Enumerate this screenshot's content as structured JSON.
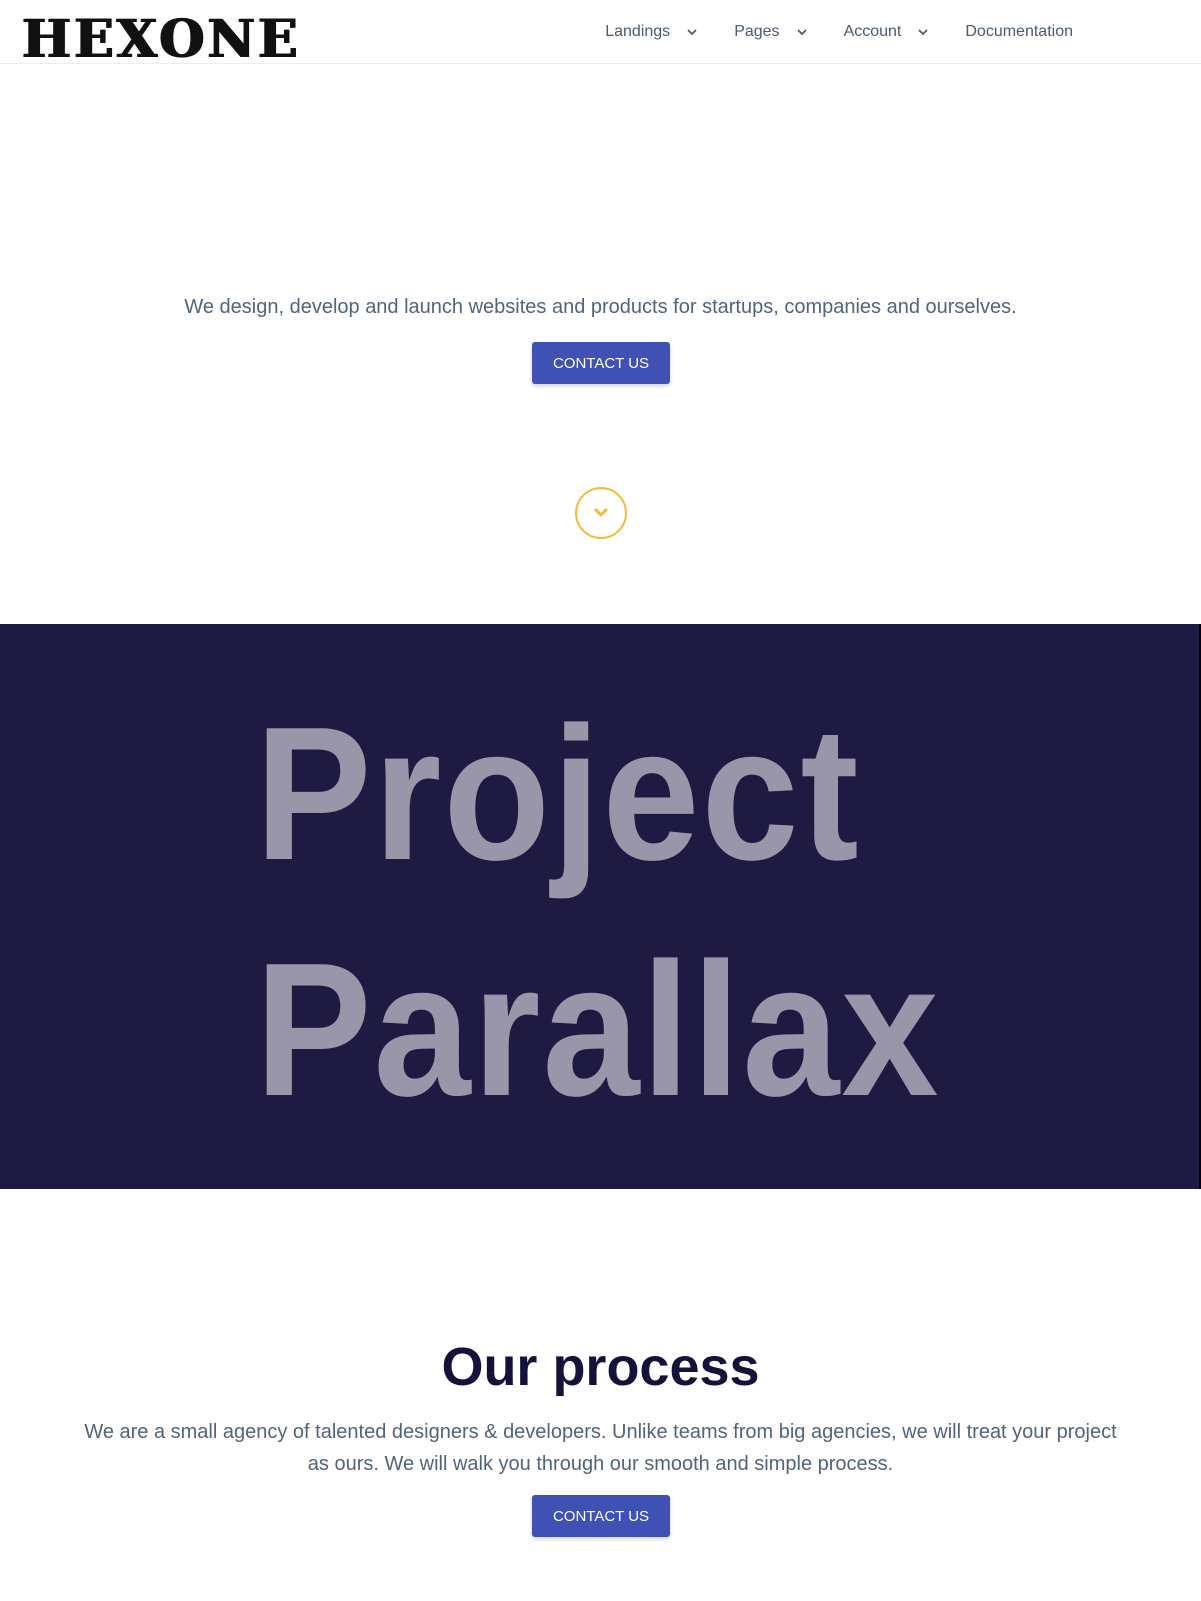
{
  "header": {
    "logo_text": "HEXONE",
    "nav": [
      {
        "label": "Landings",
        "has_dropdown": true
      },
      {
        "label": "Pages",
        "has_dropdown": true
      },
      {
        "label": "Account",
        "has_dropdown": true
      },
      {
        "label": "Documentation",
        "has_dropdown": false
      }
    ]
  },
  "hero": {
    "tagline": "We design, develop and launch websites and products for startups, companies and ourselves.",
    "cta_label": "CONTACT US",
    "scroll_icon": "chevron-down-icon"
  },
  "parallax": {
    "line1": "Project",
    "line2": "Parallax"
  },
  "process": {
    "title": "Our process",
    "description": "We are a small agency of talented designers & developers. Unlike teams from big agencies, we will treat your project as ours. We will walk you through our smooth and simple process.",
    "cta_label": "CONTACT US"
  },
  "colors": {
    "accent": "#3f51b5",
    "dark_bg": "#1f1a42",
    "scroll_ring": "#f6b93b",
    "body_text": "#50647a",
    "heading": "#14123a"
  }
}
